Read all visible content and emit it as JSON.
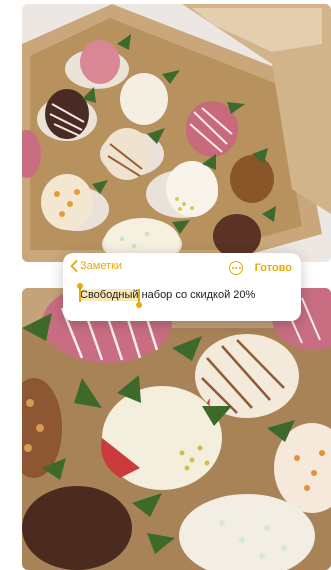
{
  "note_editor": {
    "back_label": "Заметки",
    "done_label": "Готово",
    "selected_text": "Свободный",
    "remaining_text": " набор со скидкой 20%"
  },
  "colors": {
    "accent": "#E5A90A",
    "selection": "#FBE7B5"
  },
  "icons": [
    "chevron-left-icon",
    "more-circle-icon"
  ]
}
